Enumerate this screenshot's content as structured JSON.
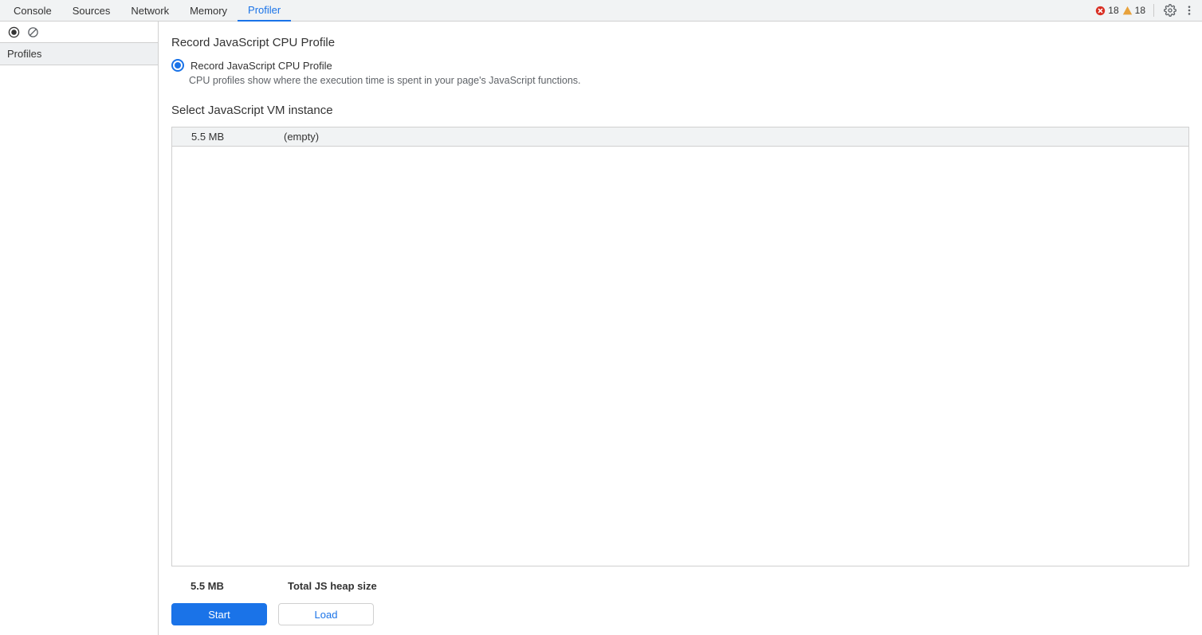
{
  "tabs": {
    "console": "Console",
    "sources": "Sources",
    "network": "Network",
    "memory": "Memory",
    "profiler": "Profiler"
  },
  "status": {
    "error_count": "18",
    "warning_count": "18"
  },
  "sidebar": {
    "section_label": "Profiles"
  },
  "content": {
    "record_title": "Record JavaScript CPU Profile",
    "record_option_label": "Record JavaScript CPU Profile",
    "record_option_desc": "CPU profiles show where the execution time is spent in your page's JavaScript functions.",
    "vm_title": "Select JavaScript VM instance",
    "vm_rows": [
      {
        "size": "5.5 MB",
        "name": "(empty)"
      }
    ],
    "footer_size": "5.5 MB",
    "footer_label": "Total JS heap size",
    "start_label": "Start",
    "load_label": "Load"
  }
}
